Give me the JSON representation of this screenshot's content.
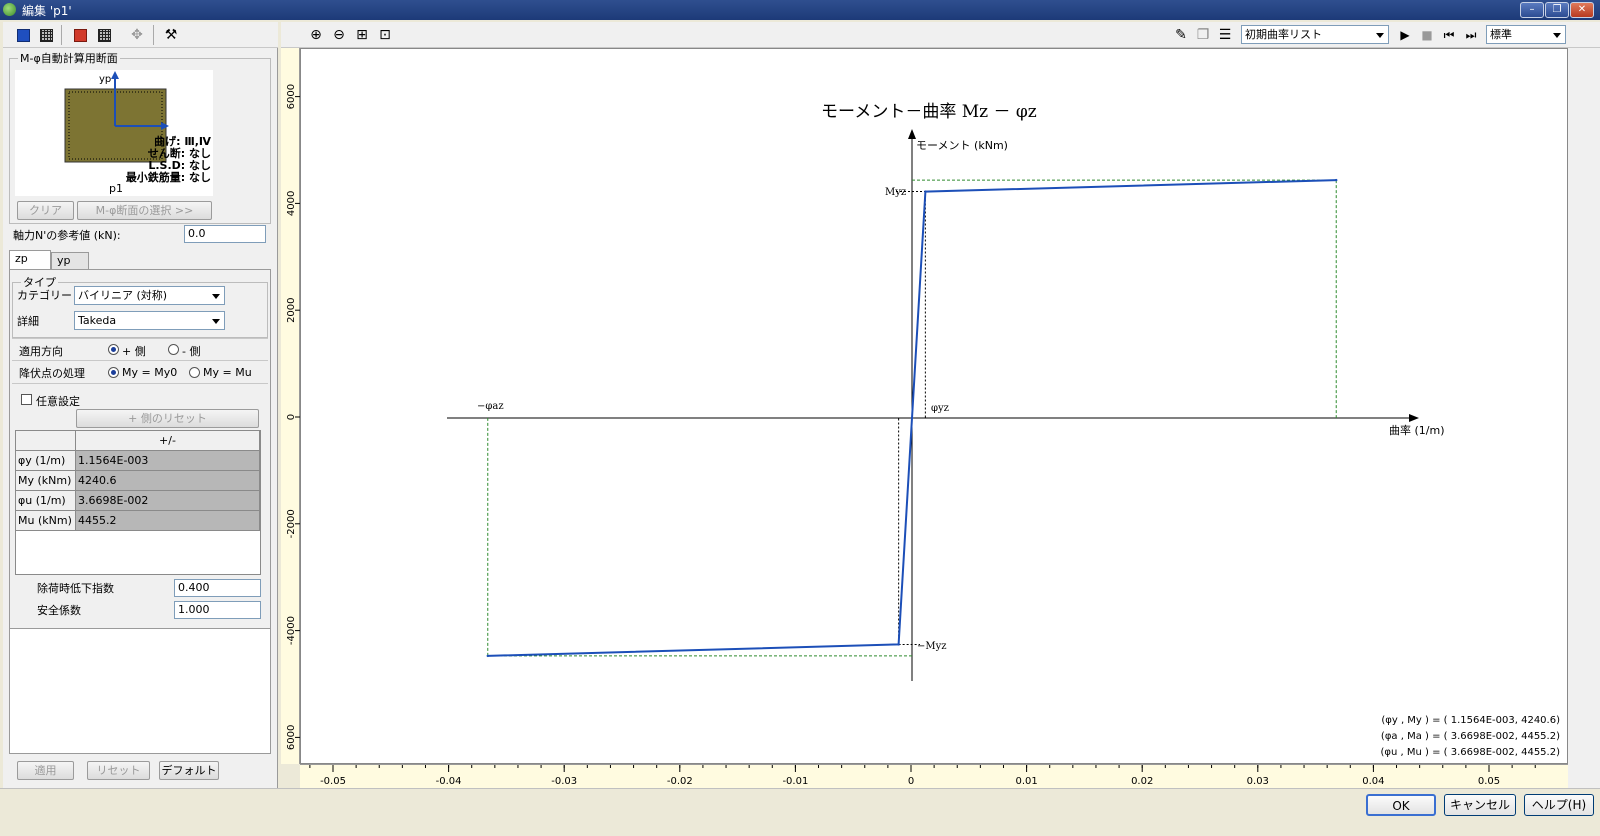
{
  "window": {
    "title": "編集 'p1'"
  },
  "section_box": {
    "legend": "M-φ自動計算用断面",
    "axis_label": "yp",
    "info_lines": [
      "曲げ: Ⅲ,Ⅳ",
      "せん断: なし",
      "L.S.D: なし",
      "最小鉄筋量: なし"
    ],
    "name": "p1",
    "clear_label": "クリア",
    "select_label": "M-φ断面の選択 >>"
  },
  "axial": {
    "label": "軸力N'の参考値 (kN):",
    "value": "0.0"
  },
  "tabs": [
    "zp",
    "yp"
  ],
  "type_group": {
    "legend": "タイプ",
    "category_label": "カテゴリー",
    "category_value": "バイリニア (対称)",
    "detail_label": "詳細",
    "detail_value": "Takeda"
  },
  "direction": {
    "label": "適用方向",
    "opt1": "+ 側",
    "opt2": "- 側"
  },
  "yield": {
    "label": "降伏点の処理",
    "opt1": "My = My0",
    "opt2": "My = Mu"
  },
  "arbitrary": {
    "label": "任意設定",
    "reset_label": "+ 側のリセット"
  },
  "params_table": {
    "header": "+/-",
    "rows": [
      {
        "label": "φy (1/m)",
        "value": "1.1564E-003"
      },
      {
        "label": "My (kNm)",
        "value": "4240.6"
      },
      {
        "label": "φu (1/m)",
        "value": "3.6698E-002"
      },
      {
        "label": "Mu (kNm)",
        "value": "4455.2"
      }
    ]
  },
  "unload": {
    "label": "除荷時低下指数",
    "value": "0.400"
  },
  "safety": {
    "label": "安全係数",
    "value": "1.000"
  },
  "bottom_buttons": {
    "apply": "適用",
    "reset": "リセット",
    "default": "デフォルト"
  },
  "right_toolbar": {
    "curve_list": "初期曲率リスト",
    "view": "標準"
  },
  "dialog_buttons": {
    "ok": "OK",
    "cancel": "キャンセル",
    "help": "ヘルプ(H)"
  },
  "colors": {
    "curve": "#1c4fb8",
    "guide": "#2e8b2e",
    "ruler": "#fffbe0"
  },
  "chart_data": {
    "type": "line",
    "title": "モーメント－曲率 Mz － φz",
    "xlabel": "曲率 (1/m)",
    "ylabel": "モーメント (kNm)",
    "xlim": [
      -0.055,
      0.056
    ],
    "ylim": [
      -6000,
      6000
    ],
    "x_ticks": [
      -0.05,
      -0.04,
      -0.03,
      -0.02,
      -0.01,
      0,
      0.01,
      0.02,
      0.03,
      0.04,
      0.05
    ],
    "x_tick_labels": [
      "-0.05",
      "-0.04",
      "-0.03",
      "-0.02",
      "-0.01",
      "0",
      "0.01",
      "0.02",
      "0.03",
      "0.04",
      "0.05"
    ],
    "y_ticks": [
      -6000,
      -4000,
      -2000,
      0,
      2000,
      4000,
      6000
    ],
    "y_tick_labels": [
      "6000",
      "-4000",
      "-2000",
      "0",
      "2000",
      "4000",
      "6000"
    ],
    "series": [
      {
        "x": [
          -0.036698,
          -0.0011564,
          0,
          0.0011564,
          0.036698
        ],
        "y": [
          -4455.2,
          -4240.6,
          0,
          4240.6,
          4455.2
        ]
      }
    ],
    "annotations": {
      "myz": "Myz",
      "neg_myz": "−Myz",
      "phiyz": "φyz",
      "neg_phiaz": "−φaz"
    },
    "legend_lines": [
      "(φy , My ) = ( 1.1564E-003, 4240.6)",
      "(φa , Ma ) = ( 3.6698E-002, 4455.2)",
      "(φu , Mu ) = ( 3.6698E-002, 4455.2)"
    ]
  }
}
